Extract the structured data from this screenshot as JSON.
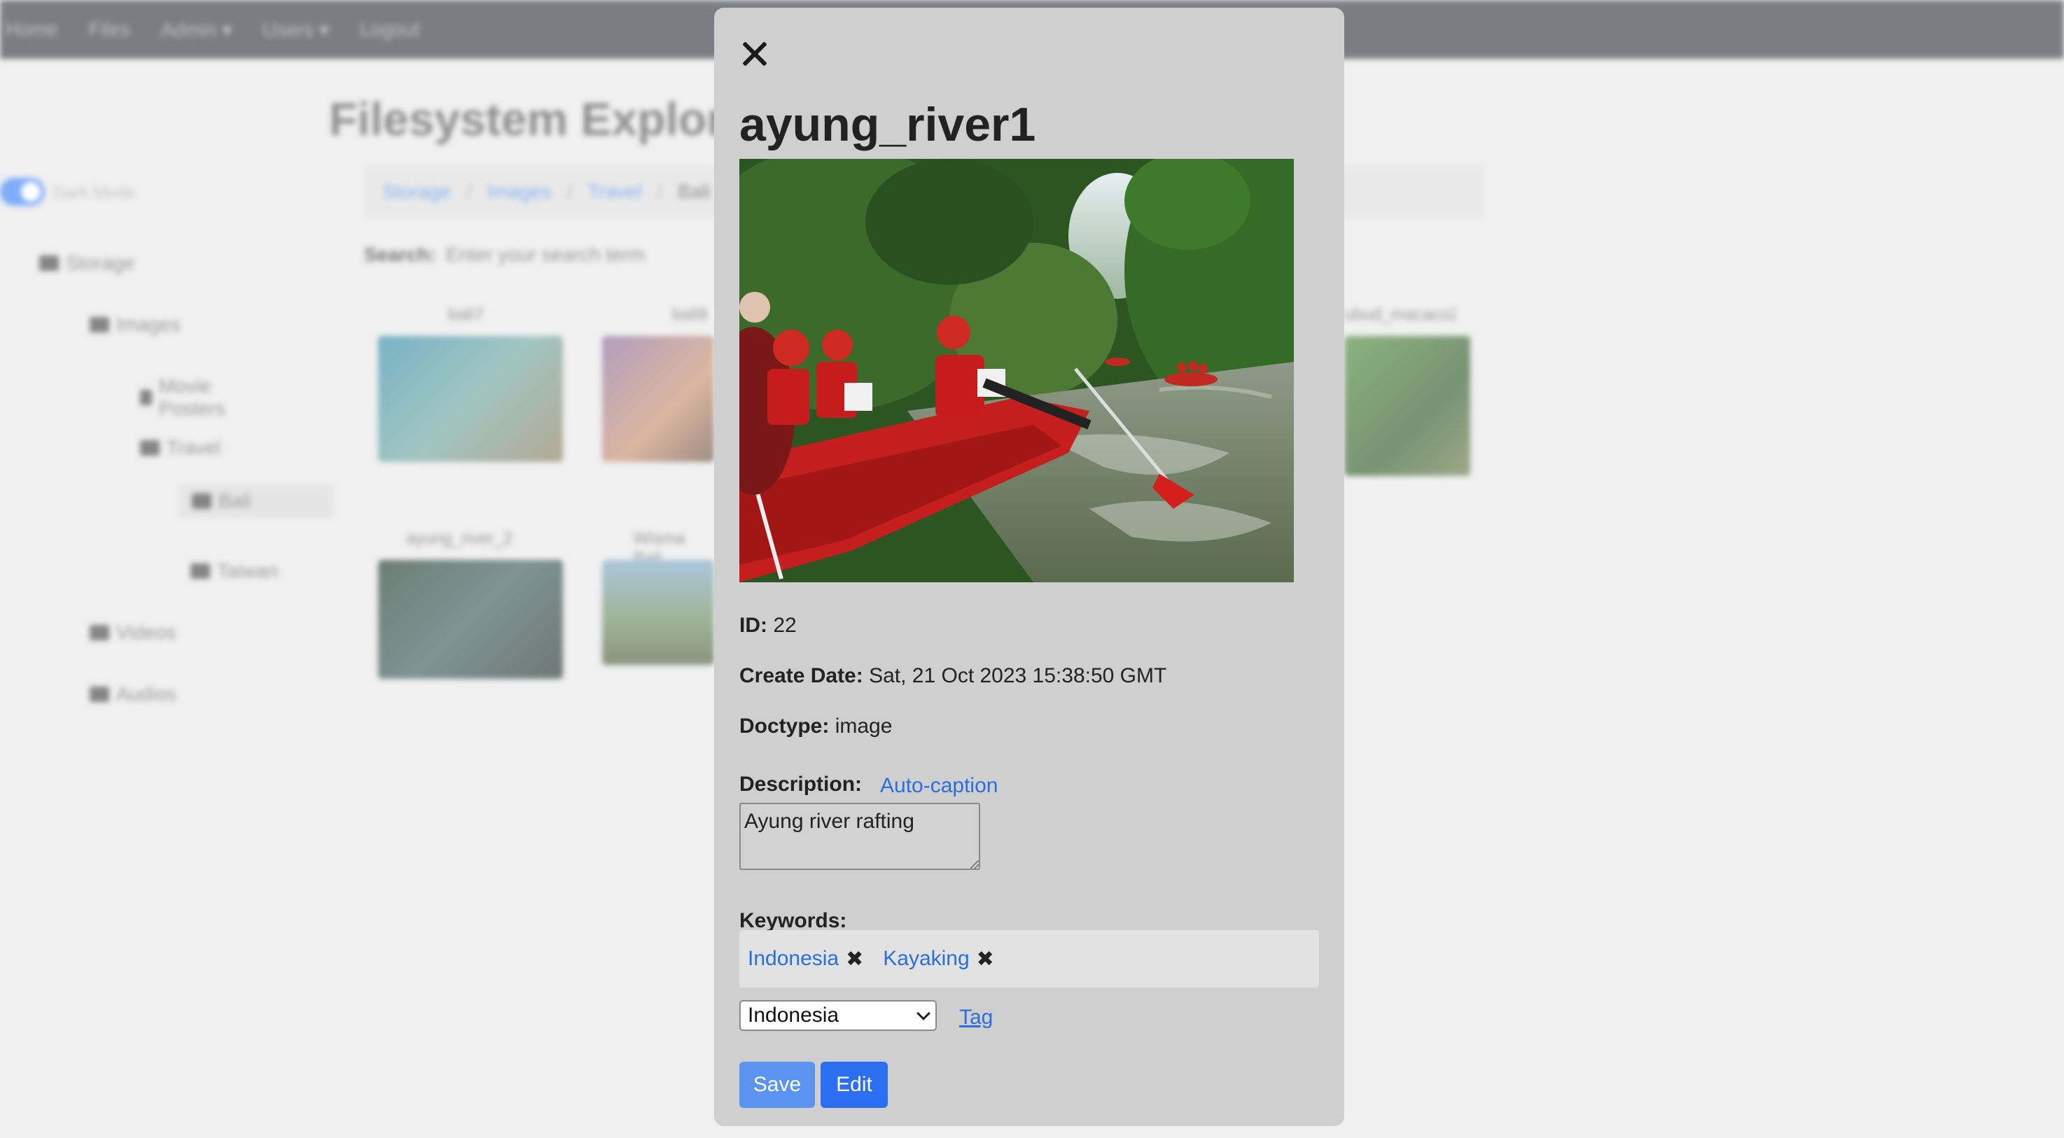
{
  "background": {
    "nav_items": [
      "Home",
      "Files",
      "Admin ▾",
      "Users ▾",
      "Logout"
    ],
    "page_title": "Filesystem Explorer",
    "toggle_label": "Dark Mode",
    "tree": [
      "Storage",
      "Images",
      "Movie Posters",
      "Travel",
      "Bali",
      "Taiwan",
      "Videos",
      "Audios"
    ],
    "breadcrumb": [
      "Storage",
      "Images",
      "Travel",
      "Bali"
    ],
    "search_label": "Search:",
    "search_placeholder": "Enter your search term",
    "thumbnails": [
      "bali7",
      "bali8",
      "ayung_river_2",
      "Wisma Bali",
      "ubud_macaco2"
    ]
  },
  "modal": {
    "title": "ayung_river1",
    "id_label": "ID:",
    "id_value": "22",
    "create_date_label": "Create Date:",
    "create_date_value": "Sat, 21 Oct 2023 15:38:50 GMT",
    "doctype_label": "Doctype:",
    "doctype_value": "image",
    "description_label": "Description:",
    "auto_caption_label": "Auto-caption",
    "description_value": "Ayung river rafting",
    "keywords_label": "Keywords:",
    "keywords": [
      "Indonesia",
      "Kayaking"
    ],
    "keyword_remove_glyph": "✖",
    "select_value": "Indonesia",
    "tag_label": "Tag",
    "save_label": "Save",
    "edit_label": "Edit"
  },
  "colors": {
    "accent": "#2b6ef2",
    "link": "#2a6fdb",
    "modal_bg": "#cfcfcf",
    "navbar": "#343a40"
  }
}
